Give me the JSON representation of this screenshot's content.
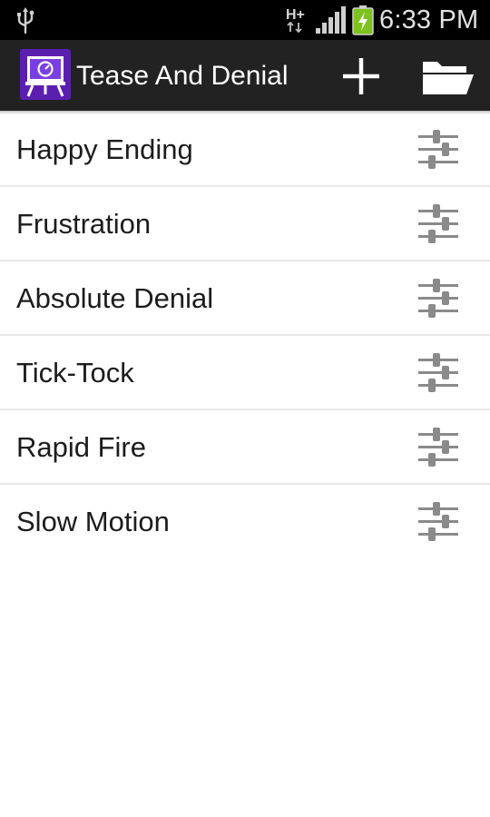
{
  "status_bar": {
    "network_type": "H+",
    "time": "6:33 PM",
    "icons": [
      "usb-icon",
      "network-type-icon",
      "signal-icon",
      "battery-charging-icon"
    ]
  },
  "action_bar": {
    "title": "Tease And Denial",
    "icons": [
      "app-icon",
      "add-icon",
      "folder-open-icon"
    ]
  },
  "list": {
    "items": [
      {
        "label": "Happy Ending"
      },
      {
        "label": "Frustration"
      },
      {
        "label": "Absolute Denial"
      },
      {
        "label": "Tick-Tock"
      },
      {
        "label": "Rapid Fire"
      },
      {
        "label": "Slow Motion"
      }
    ],
    "item_icon": "settings-sliders-icon"
  },
  "colors": {
    "status_bar": "#000000",
    "action_bar": "#222222",
    "app_icon_purple": "#5b1fb0",
    "battery_green": "#7dc21e",
    "slider_icon": "#8a8a8a"
  }
}
